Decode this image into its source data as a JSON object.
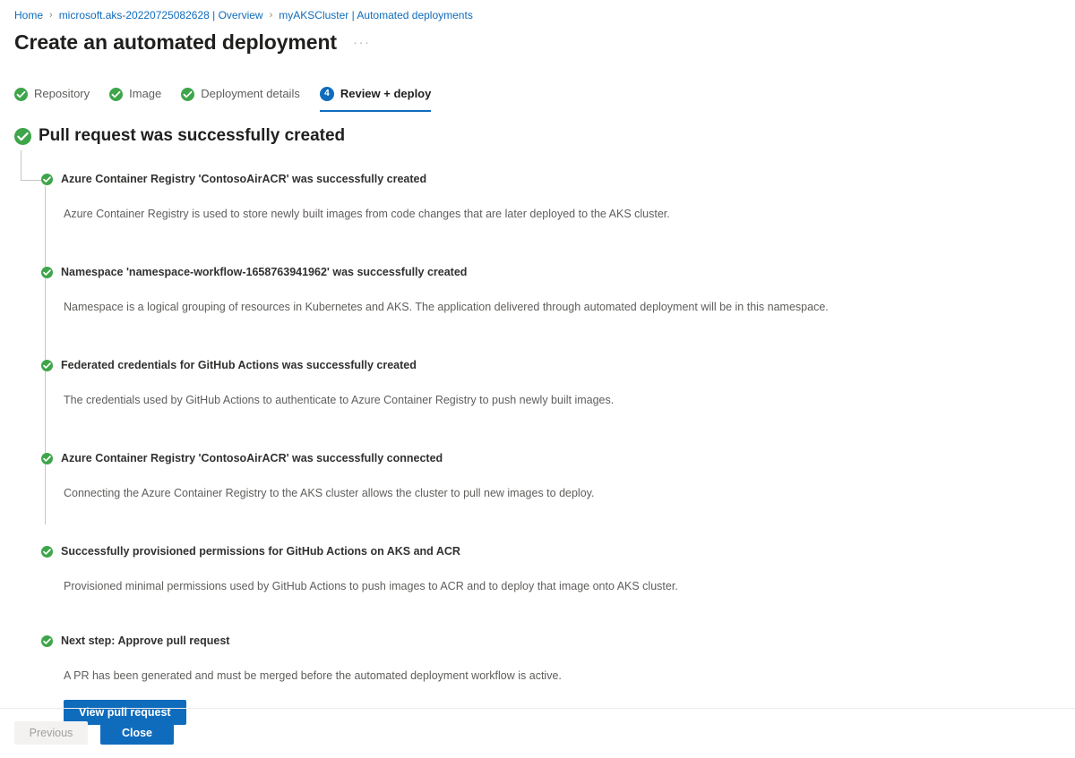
{
  "breadcrumb": {
    "separator": "›",
    "items": [
      {
        "label": "Home"
      },
      {
        "label": "microsoft.aks-20220725082628 | Overview"
      },
      {
        "label": "myAKSCluster | Automated deployments"
      }
    ]
  },
  "header": {
    "title": "Create an automated deployment",
    "more_actions": "···"
  },
  "wizard": {
    "tabs": [
      {
        "label": "Repository",
        "state": "complete",
        "icon": "check-circle-icon"
      },
      {
        "label": "Image",
        "state": "complete",
        "icon": "check-circle-icon"
      },
      {
        "label": "Deployment details",
        "state": "complete",
        "icon": "check-circle-icon"
      },
      {
        "label": "Review + deploy",
        "state": "active",
        "badge": "4",
        "icon": "step-number-badge"
      }
    ]
  },
  "status": {
    "icon": "check-circle-icon",
    "heading": "Pull request was successfully created"
  },
  "results": [
    {
      "icon": "check-circle-icon",
      "title": "Azure Container Registry 'ContosoAirACR' was successfully created",
      "description": "Azure Container Registry is used to store newly built images from code changes that are later deployed to the AKS cluster."
    },
    {
      "icon": "check-circle-icon",
      "title": "Namespace 'namespace-workflow-1658763941962' was successfully created",
      "description": "Namespace is a logical grouping of resources in Kubernetes and AKS. The application delivered through automated deployment will be in this namespace."
    },
    {
      "icon": "check-circle-icon",
      "title": "Federated credentials for GitHub Actions was successfully created",
      "description": "The credentials used by GitHub Actions to authenticate to Azure Container Registry to push newly built images."
    },
    {
      "icon": "check-circle-icon",
      "title": "Azure Container Registry 'ContosoAirACR' was successfully connected",
      "description": "Connecting the Azure Container Registry to the AKS cluster allows the cluster to pull new images to deploy."
    },
    {
      "icon": "check-circle-icon",
      "title": "Successfully provisioned permissions for GitHub Actions on AKS and ACR",
      "description": "Provisioned minimal permissions used by GitHub Actions to push images to ACR and to deploy that image onto AKS cluster."
    },
    {
      "icon": "check-circle-icon",
      "title": "Next step: Approve pull request",
      "description": "A PR has been generated and must be merged before the automated deployment workflow is active.",
      "action_label": "View pull request"
    }
  ],
  "footer": {
    "previous_label": "Previous",
    "previous_disabled": true,
    "close_label": "Close"
  },
  "colors": {
    "accent": "#0f6cbd",
    "success": "#3ea54a",
    "link": "#0f6cbd",
    "text_primary": "#201f1e",
    "text_secondary": "#605e5c",
    "divider": "#edebe9",
    "tree_line": "#c8c6c4",
    "disabled_bg": "#f3f2f1"
  }
}
